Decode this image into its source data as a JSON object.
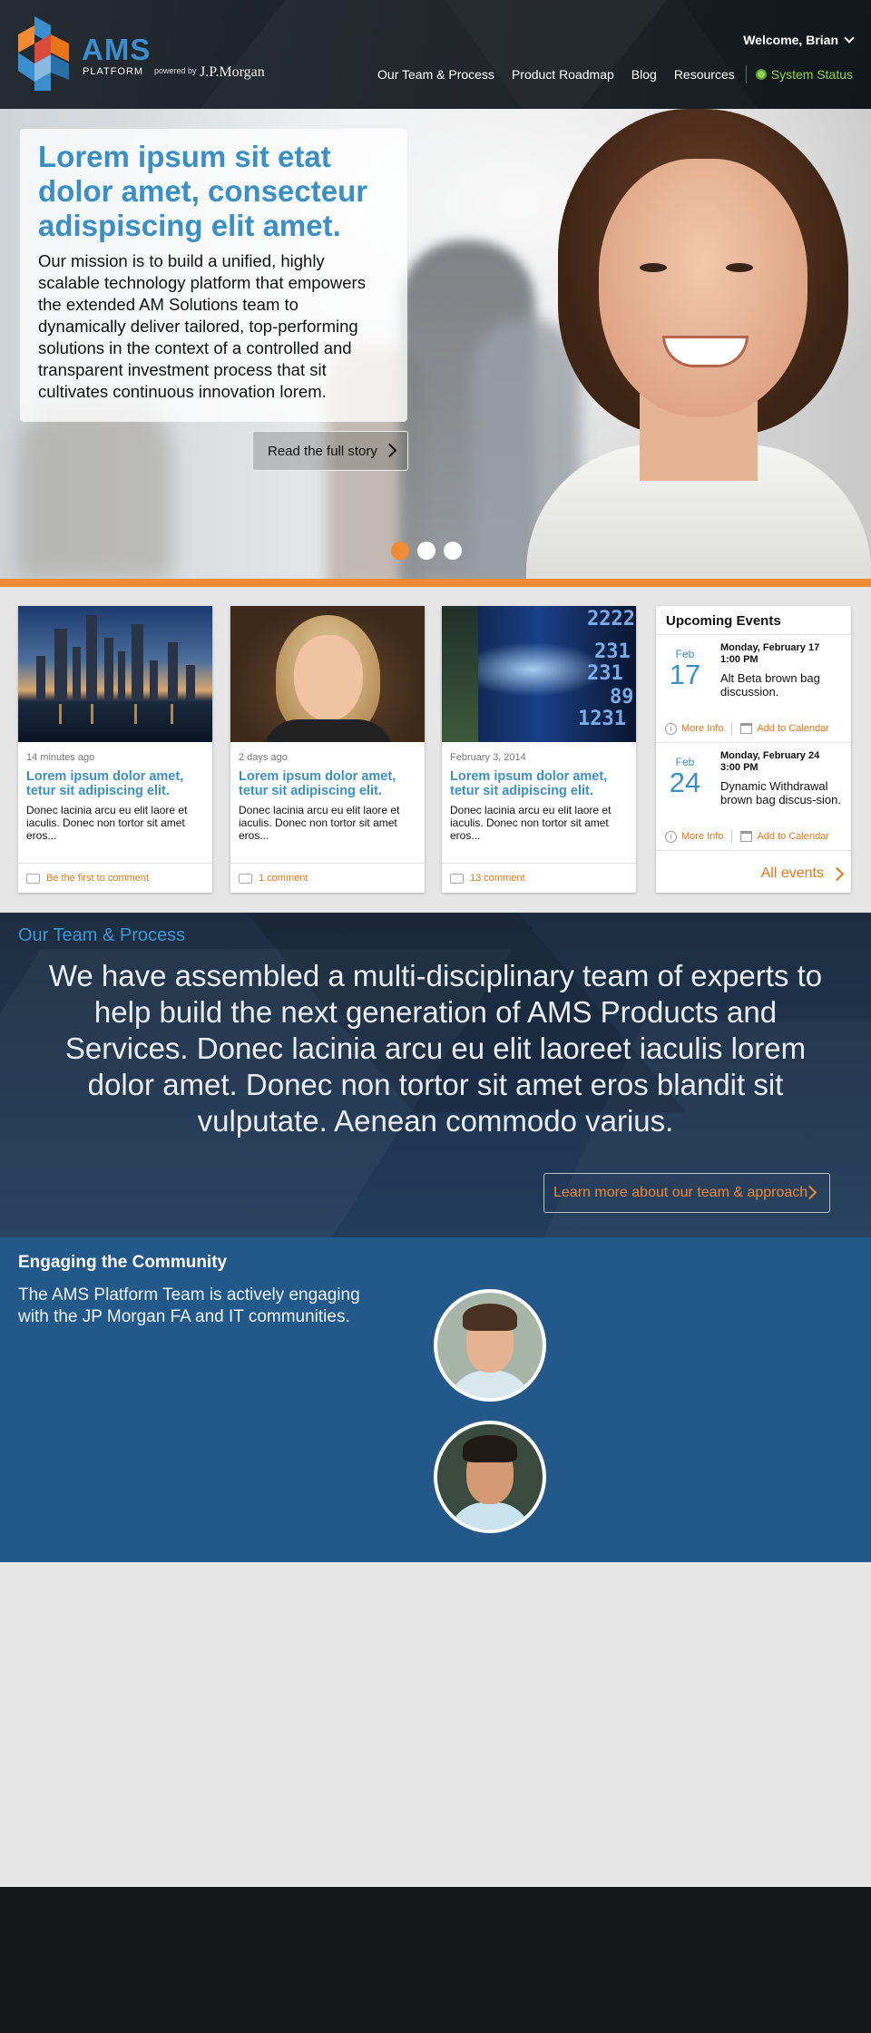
{
  "header": {
    "logo_name": "AMS",
    "logo_sub": "PLATFORM",
    "powered_by": "powered by",
    "powered_brand": "J.P.Morgan",
    "welcome": "Welcome, Brian",
    "nav": [
      "Our Team & Process",
      "Product Roadmap",
      "Blog",
      "Resources"
    ],
    "status": "System Status",
    "colors": {
      "accent": "#3b8fcf",
      "status": "#8ed24f",
      "orange": "#f08a34"
    }
  },
  "hero": {
    "title": "Lorem ipsum sit etat dolor amet, consecteur adispiscing elit amet.",
    "text": "Our mission is to build a unified, highly scalable technology platform that empowers the extended AM Solutions team to dynamically deliver tailored, top-performing solutions in the context of a controlled and transparent investment process that sit cultivates continuous innovation lorem.",
    "button": "Read the full story",
    "slides": 3,
    "active_slide": 1
  },
  "cards": [
    {
      "date": "14 minutes ago",
      "title": "Lorem ipsum dolor amet, tetur sit adipiscing elit.",
      "body": "Donec lacinia arcu eu elit laore et iaculis. Donec non tortor sit amet eros...",
      "comment": "Be the first to comment"
    },
    {
      "date": "2 days ago",
      "title": "Lorem ipsum dolor amet, tetur sit adipiscing elit.",
      "body": "Donec lacinia arcu eu elit laore et iaculis. Donec non tortor sit amet eros...",
      "comment": "1 comment"
    },
    {
      "date": "February 3, 2014",
      "title": "Lorem ipsum dolor amet, tetur sit adipiscing elit.",
      "body": "Donec lacinia arcu eu elit laore et iaculis. Donec non tortor sit amet eros...",
      "comment": "13 comment"
    }
  ],
  "stock_numbers": [
    "2222",
    "231",
    "231",
    "89",
    "1231"
  ],
  "events": {
    "title": "Upcoming Events",
    "items": [
      {
        "month": "Feb",
        "day": "17",
        "when1": "Monday, February 17",
        "when2": "1:00 PM",
        "what": "Alt Beta brown bag discussion.",
        "info": "More Info",
        "cal": "Add to Calendar"
      },
      {
        "month": "Feb",
        "day": "24",
        "when1": "Monday, February 24",
        "when2": "3:00 PM",
        "what": "Dynamic Withdrawal brown bag discus-sion.",
        "info": "More Info",
        "cal": "Add to Calendar"
      }
    ],
    "all": "All events"
  },
  "team": {
    "heading": "Our Team & Process",
    "text": "We have assembled a multi-disciplinary team of experts to help build the next generation of AMS Products and Services. Donec lacinia arcu eu elit laoreet iaculis lorem dolor amet. Donec non tortor sit amet eros blandit sit vulputate. Aenean commodo varius.",
    "button": "Learn more about our team & approach"
  },
  "community": {
    "heading": "Engaging the Community",
    "text": "The AMS Platform Team is actively engaging with the JP Morgan FA and IT communities."
  }
}
